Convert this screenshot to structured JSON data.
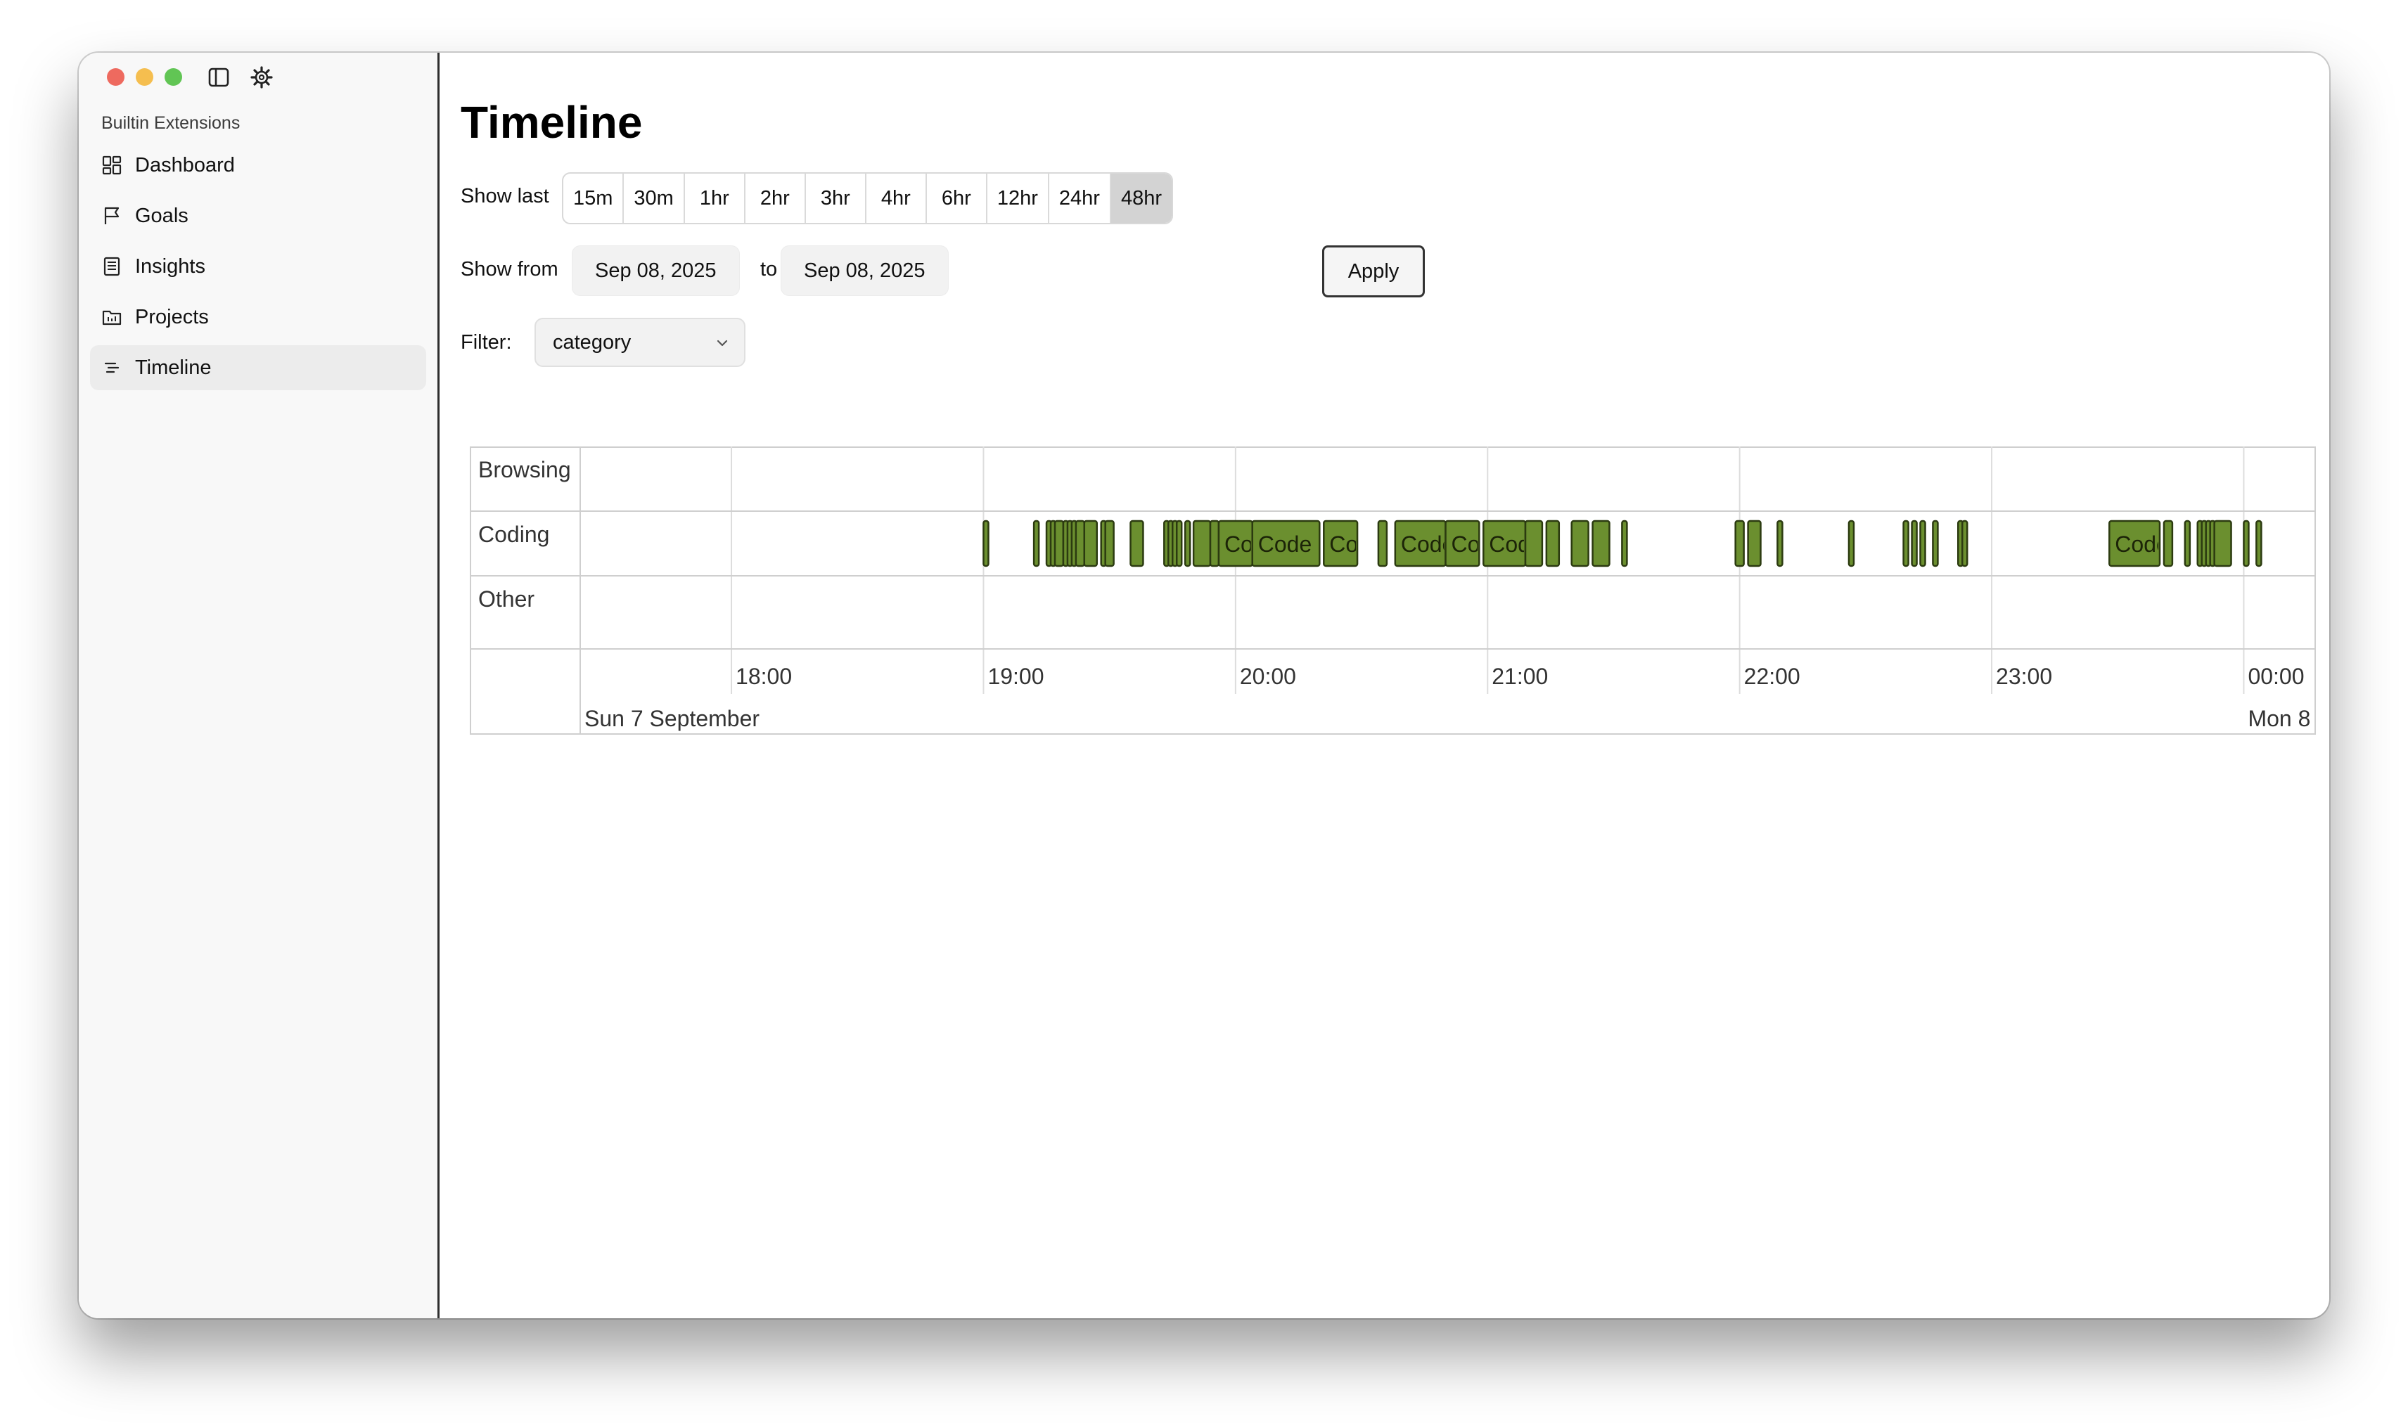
{
  "sidebar": {
    "section_title": "Builtin Extensions",
    "items": [
      {
        "label": "Dashboard",
        "icon": "dashboard-grid-icon"
      },
      {
        "label": "Goals",
        "icon": "flag-icon"
      },
      {
        "label": "Insights",
        "icon": "document-list-icon"
      },
      {
        "label": "Projects",
        "icon": "folder-icon"
      },
      {
        "label": "Timeline",
        "icon": "timeline-lines-icon",
        "active": true
      }
    ]
  },
  "main": {
    "title": "Timeline",
    "show_last_label": "Show last",
    "ranges": [
      "15m",
      "30m",
      "1hr",
      "2hr",
      "3hr",
      "4hr",
      "6hr",
      "12hr",
      "24hr",
      "48hr"
    ],
    "selected_range": "48hr",
    "show_from_label": "Show from",
    "from_date": "Sep 08, 2025",
    "to_label": "to",
    "to_date": "Sep 08, 2025",
    "apply_label": "Apply",
    "filter_label": "Filter:",
    "filter_value": "category"
  },
  "colors": {
    "bar_fill": "#6b8f2f",
    "bar_stroke": "#2b3a10",
    "grid": "#dddddd"
  },
  "timeline": {
    "rows": [
      "Browsing",
      "Coding",
      "Other"
    ],
    "ticks": [
      "18:00",
      "19:00",
      "20:00",
      "21:00",
      "22:00",
      "23:00",
      "00:00"
    ],
    "day_labels": {
      "start": "Sun 7 September",
      "end": "Mon 8"
    },
    "view_start": "17:24",
    "view_end": "00:17",
    "bar_label": "Code",
    "events": [
      {
        "row": "Coding",
        "start": "19:00",
        "end": "19:01"
      },
      {
        "row": "Coding",
        "start": "19:12",
        "end": "19:13"
      },
      {
        "row": "Coding",
        "start": "19:15",
        "end": "19:16"
      },
      {
        "row": "Coding",
        "start": "19:16",
        "end": "19:17"
      },
      {
        "row": "Coding",
        "start": "19:17",
        "end": "19:19"
      },
      {
        "row": "Coding",
        "start": "19:19",
        "end": "19:20"
      },
      {
        "row": "Coding",
        "start": "19:20",
        "end": "19:21"
      },
      {
        "row": "Coding",
        "start": "19:21",
        "end": "19:22"
      },
      {
        "row": "Coding",
        "start": "19:22",
        "end": "19:24"
      },
      {
        "row": "Coding",
        "start": "19:24",
        "end": "19:27"
      },
      {
        "row": "Coding",
        "start": "19:28",
        "end": "19:29"
      },
      {
        "row": "Coding",
        "start": "19:29",
        "end": "19:31"
      },
      {
        "row": "Coding",
        "start": "19:35",
        "end": "19:38"
      },
      {
        "row": "Coding",
        "start": "19:43",
        "end": "19:44"
      },
      {
        "row": "Coding",
        "start": "19:44",
        "end": "19:45"
      },
      {
        "row": "Coding",
        "start": "19:45",
        "end": "19:46"
      },
      {
        "row": "Coding",
        "start": "19:46",
        "end": "19:47"
      },
      {
        "row": "Coding",
        "start": "19:48",
        "end": "19:49"
      },
      {
        "row": "Coding",
        "start": "19:50",
        "end": "19:54"
      },
      {
        "row": "Coding",
        "start": "19:54",
        "end": "19:56"
      },
      {
        "row": "Coding",
        "start": "19:56",
        "end": "20:04"
      },
      {
        "row": "Coding",
        "start": "20:04",
        "end": "20:20"
      },
      {
        "row": "Coding",
        "start": "20:21",
        "end": "20:29"
      },
      {
        "row": "Coding",
        "start": "20:34",
        "end": "20:36"
      },
      {
        "row": "Coding",
        "start": "20:38",
        "end": "20:50"
      },
      {
        "row": "Coding",
        "start": "20:50",
        "end": "20:58"
      },
      {
        "row": "Coding",
        "start": "20:59",
        "end": "21:09"
      },
      {
        "row": "Coding",
        "start": "21:09",
        "end": "21:13"
      },
      {
        "row": "Coding",
        "start": "21:14",
        "end": "21:17"
      },
      {
        "row": "Coding",
        "start": "21:20",
        "end": "21:24"
      },
      {
        "row": "Coding",
        "start": "21:25",
        "end": "21:29"
      },
      {
        "row": "Coding",
        "start": "21:32",
        "end": "21:33"
      },
      {
        "row": "Coding",
        "start": "21:59",
        "end": "22:01"
      },
      {
        "row": "Coding",
        "start": "22:02",
        "end": "22:05"
      },
      {
        "row": "Coding",
        "start": "22:09",
        "end": "22:10"
      },
      {
        "row": "Coding",
        "start": "22:26",
        "end": "22:27"
      },
      {
        "row": "Coding",
        "start": "22:39",
        "end": "22:40"
      },
      {
        "row": "Coding",
        "start": "22:41",
        "end": "22:42"
      },
      {
        "row": "Coding",
        "start": "22:43",
        "end": "22:44"
      },
      {
        "row": "Coding",
        "start": "22:46",
        "end": "22:47"
      },
      {
        "row": "Coding",
        "start": "22:52",
        "end": "22:53"
      },
      {
        "row": "Coding",
        "start": "22:53",
        "end": "22:54"
      },
      {
        "row": "Coding",
        "start": "23:28",
        "end": "23:40"
      },
      {
        "row": "Coding",
        "start": "23:41",
        "end": "23:43"
      },
      {
        "row": "Coding",
        "start": "23:46",
        "end": "23:47"
      },
      {
        "row": "Coding",
        "start": "23:49",
        "end": "23:50"
      },
      {
        "row": "Coding",
        "start": "23:50",
        "end": "23:51"
      },
      {
        "row": "Coding",
        "start": "23:51",
        "end": "23:52"
      },
      {
        "row": "Coding",
        "start": "23:52",
        "end": "23:53"
      },
      {
        "row": "Coding",
        "start": "23:53",
        "end": "23:57"
      },
      {
        "row": "Coding",
        "start": "00:00",
        "end": "00:01"
      },
      {
        "row": "Coding",
        "start": "00:03",
        "end": "00:04"
      }
    ]
  }
}
